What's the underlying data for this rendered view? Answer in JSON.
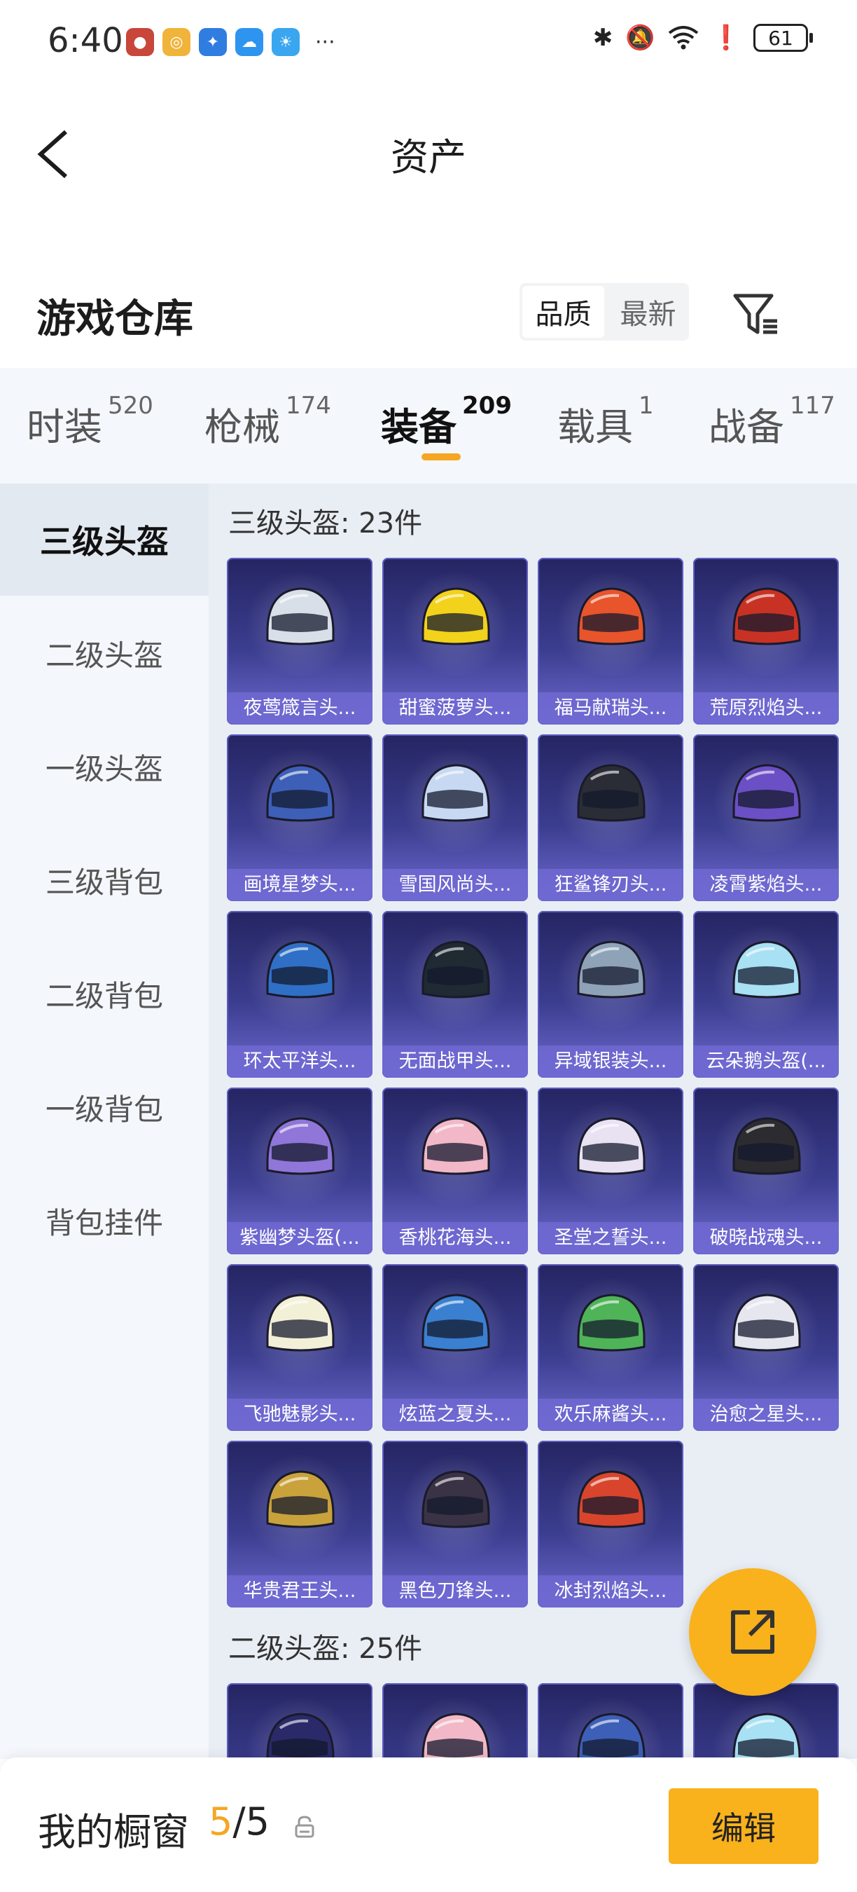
{
  "status_bar": {
    "time": "6:40",
    "battery": "61",
    "app_icons": [
      "game-app-icon",
      "target-app-icon",
      "bulb-app-icon",
      "cloud-app-icon",
      "weather-app-icon"
    ],
    "more": "···"
  },
  "header": {
    "title": "资产"
  },
  "warehouse": {
    "title": "游戏仓库",
    "sort": {
      "options": [
        "品质",
        "最新"
      ],
      "active": "品质"
    }
  },
  "category_tabs": [
    {
      "label": "时装",
      "count": "520"
    },
    {
      "label": "枪械",
      "count": "174"
    },
    {
      "label": "装备",
      "count": "209",
      "active": true
    },
    {
      "label": "载具",
      "count": "1"
    },
    {
      "label": "战备",
      "count": "117"
    }
  ],
  "sidebar": {
    "items": [
      "三级头盔",
      "二级头盔",
      "一级头盔",
      "三级背包",
      "二级背包",
      "一级背包",
      "背包挂件"
    ],
    "active": "三级头盔"
  },
  "sections": [
    {
      "title": "三级头盔: 23件",
      "items": [
        {
          "name": "夜莺箴言头...",
          "color": "#d9dfe8"
        },
        {
          "name": "甜蜜菠萝头...",
          "color": "#f2d21b"
        },
        {
          "name": "福马献瑞头...",
          "color": "#e8542c"
        },
        {
          "name": "荒原烈焰头...",
          "color": "#c83224"
        },
        {
          "name": "画境星梦头...",
          "color": "#3d5fb8"
        },
        {
          "name": "雪国风尚头...",
          "color": "#c7d8f3"
        },
        {
          "name": "狂鲨锋刃头...",
          "color": "#2a2d36"
        },
        {
          "name": "凌霄紫焰头...",
          "color": "#6b4fc4"
        },
        {
          "name": "环太平洋头...",
          "color": "#2f6fc6"
        },
        {
          "name": "无面战甲头...",
          "color": "#1f2a33"
        },
        {
          "name": "异域银装头...",
          "color": "#8fa3b8"
        },
        {
          "name": "云朵鹅头盔(...",
          "color": "#a8e0f4"
        },
        {
          "name": "紫幽梦头盔(...",
          "color": "#8f76d8"
        },
        {
          "name": "香桃花海头...",
          "color": "#f2b8c8"
        },
        {
          "name": "圣堂之誓头...",
          "color": "#e8e2f2"
        },
        {
          "name": "破晓战魂头...",
          "color": "#2b2b30"
        },
        {
          "name": "飞驰魅影头...",
          "color": "#f3f0d8"
        },
        {
          "name": "炫蓝之夏头...",
          "color": "#3a7fd0"
        },
        {
          "name": "欢乐麻酱头...",
          "color": "#4fb358"
        },
        {
          "name": "治愈之星头...",
          "color": "#e6e6ef"
        },
        {
          "name": "华贵君王头...",
          "color": "#c9a23c"
        },
        {
          "name": "黑色刀锋头...",
          "color": "#3a3346"
        },
        {
          "name": "冰封烈焰头...",
          "color": "#d8452c"
        }
      ]
    },
    {
      "title": "二级头盔: 25件",
      "items": [
        {
          "name": "",
          "color": "#2a2a6a"
        },
        {
          "name": "",
          "color": "#f2b8c8"
        },
        {
          "name": "",
          "color": "#3d5fb8"
        },
        {
          "name": "",
          "color": "#a8e0f4"
        }
      ]
    }
  ],
  "bottom_bar": {
    "showcase_label": "我的橱窗",
    "count_current": "5",
    "count_sep": "/",
    "count_max": "5",
    "edit_label": "编辑"
  },
  "colors": {
    "accent": "#f9b11c",
    "tab_underline": "#f5a623",
    "card_bg": "#3b3d8f"
  }
}
